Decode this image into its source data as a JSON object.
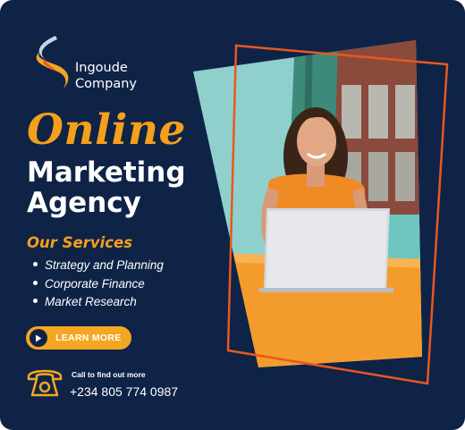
{
  "brand": {
    "line1": "Ingoude",
    "line2": "Company"
  },
  "headline": {
    "script": "Online",
    "line1": "Marketing",
    "line2": "Agency"
  },
  "services": {
    "title": "Our Services",
    "items": [
      "Strategy and Planning",
      "Corporate Finance",
      "Market Research"
    ]
  },
  "cta": {
    "label": "LEARN MORE"
  },
  "contact": {
    "caption": "Call to find out more",
    "phone": "+234 805 774 0987"
  },
  "colors": {
    "background": "#0f2347",
    "accent": "#f5a623",
    "frame": "#e8581f",
    "text": "#ffffff"
  },
  "icons": {
    "logo": "swoosh-logo-icon",
    "cta": "play-icon",
    "contact": "telephone-icon"
  }
}
